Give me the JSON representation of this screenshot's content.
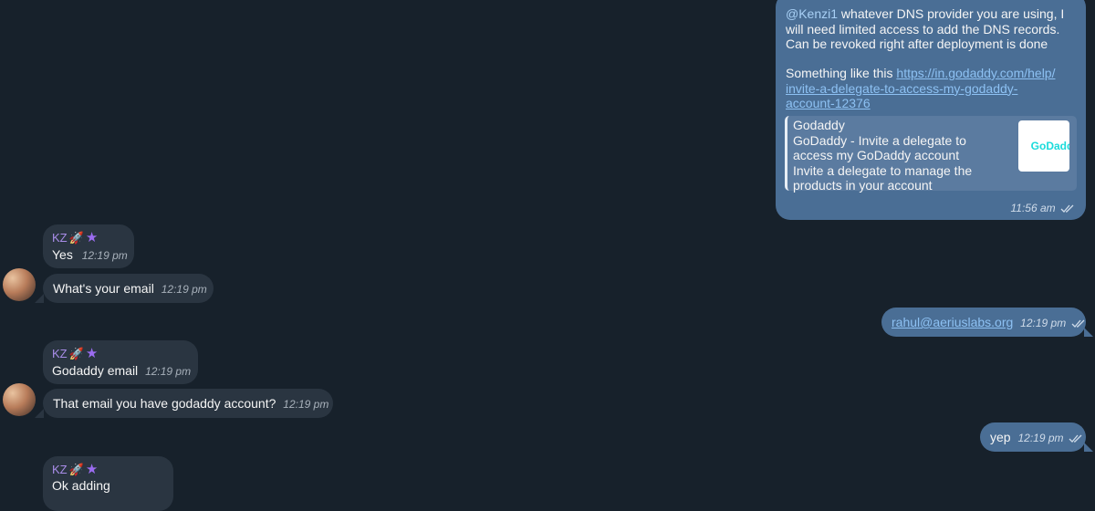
{
  "messages": {
    "m1": {
      "mention": "@Kenzi1",
      "text": " whatever DNS provider you are using, I will need limited access to add the DNS records. Can be revoked right after deployment is done",
      "text2": "Something like this ",
      "link": "https://in.godaddy.com/help/invite-a-delegate-to-access-my-godaddy-account-12376",
      "link_lines": [
        "https://in.godaddy.com/help/",
        "invite-a-delegate-to-access-my-godaddy-",
        "account-12376"
      ],
      "preview": {
        "site": "Godaddy",
        "title": "GoDaddy - Invite a delegate to access my GoDaddy account",
        "description": "Invite a delegate to manage the products in your account",
        "thumb_text": "GoDadd"
      },
      "time": "11:56 am"
    },
    "m2": {
      "sender": "KZ",
      "text": "Yes",
      "time": "12:19 pm"
    },
    "m3": {
      "text": "What's your email",
      "time": "12:19 pm"
    },
    "m4": {
      "link": "rahul@aeriuslabs.org",
      "time": "12:19 pm"
    },
    "m5": {
      "sender": "KZ",
      "text": "Godaddy email",
      "time": "12:19 pm"
    },
    "m6": {
      "text": "That email you have godaddy account?",
      "time": "12:19 pm"
    },
    "m7": {
      "text": "yep",
      "time": "12:19 pm"
    },
    "m8": {
      "sender": "KZ",
      "text": "Ok adding"
    }
  },
  "colors": {
    "background": "#17212b",
    "incoming_bubble": "#2a3541",
    "outgoing_bubble": "#4a6e95",
    "sender_name": "#a98de8",
    "link": "#8dc1f3"
  },
  "icons": {
    "sender_badges": [
      "rocket-icon",
      "star-icon"
    ],
    "read_status": "double-check-icon"
  }
}
